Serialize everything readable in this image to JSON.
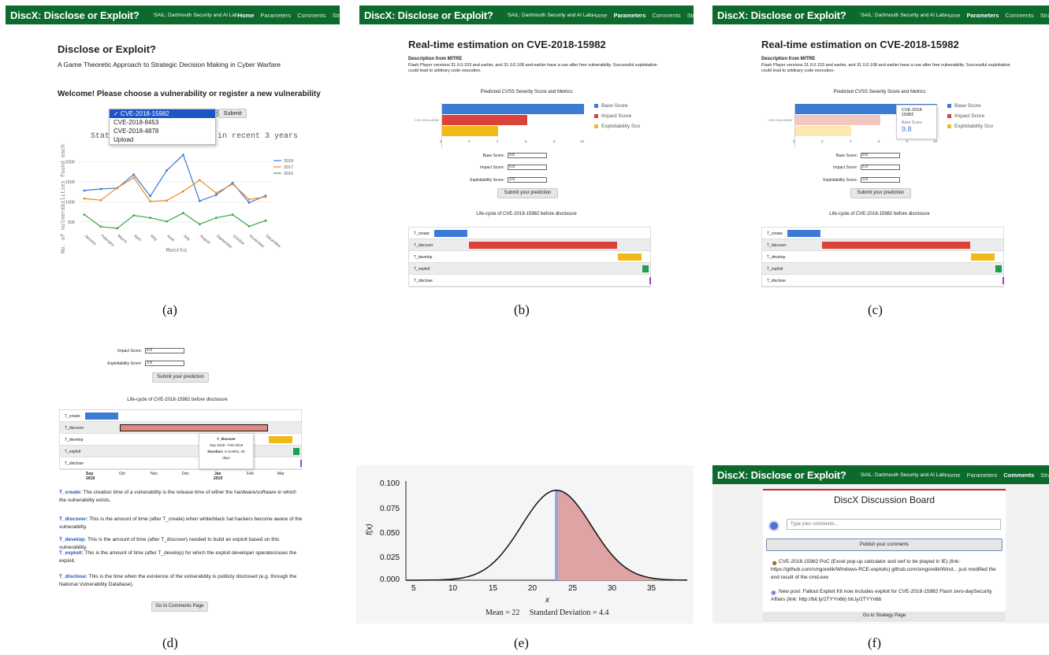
{
  "nav": {
    "brand": "DiscX: Disclose or Exploit?",
    "lab": "DSAIL: Dartmouth Security and AI Lab",
    "links": [
      "Home",
      "Parameters",
      "Comments",
      "Strategy"
    ]
  },
  "captions": [
    "(a)",
    "(b)",
    "(c)",
    "(d)",
    "(e)",
    "(f)"
  ],
  "panel_a": {
    "title": "Disclose or Exploit?",
    "subtitle": "A Game Theoretic Approach to Strategic Decision Making in Cyber Warfare",
    "welcome": "Welcome! Please choose a vulnerability or register a new vulnerability",
    "options": [
      "✓ CVE-2018-15982",
      "CVE-2018-8453",
      "CVE-2018-4878",
      "Upload"
    ],
    "submit": "Submit",
    "chart_title_left": "Stati",
    "chart_title_right": "in recent 3 years",
    "ylabel": "No. of vulnerabilities found each year",
    "xlabel": "Months"
  },
  "panel_b": {
    "title": "Real-time estimation on CVE-2018-15982",
    "desc_head": "Description from MITRE",
    "desc": "Flash Player versions 31.0.0.153 and earlier, and 31.0.0.108 and earlier have a use after free vulnerability. Successful exploitation could lead to arbitrary code execution.",
    "chart_head": "Predicted CVSS Severity Score and Metrics",
    "cve_label": "CVE-2018-15982",
    "legend": [
      "Base Score",
      "Impact Score",
      "Exploitability Sco"
    ],
    "fields": [
      {
        "label": "Base Score:",
        "value": "9.8"
      },
      {
        "label": "Impact Score:",
        "value": "5.9"
      },
      {
        "label": "Exploitability Score:",
        "value": "3.9"
      }
    ],
    "submit": "Submit your prediction",
    "lifecycle": "Life-cycle of CVE-2018-15982 before disclosure",
    "rows": [
      "T_create",
      "T_discover",
      "T_develop",
      "T_exploit",
      "T_disclose"
    ],
    "months": [
      "Sep",
      "Oct",
      "Nov",
      "Dec",
      "Jan",
      "Feb",
      "Mar"
    ]
  },
  "panel_c": {
    "tip_title": "CVE-2018-15982",
    "tip_label": "Base Score",
    "tip_value": "9.8"
  },
  "panel_d": {
    "fields": [
      {
        "label": "Impact Score:",
        "value": "5.9"
      },
      {
        "label": "Exploitability Score:",
        "value": "3.9"
      }
    ],
    "tip_title": "T_discover",
    "tip_range": "Sep 2018 - Feb 2019",
    "tip_duration_label": "Duration:",
    "tip_duration": "4 months, 20 days",
    "year": "2018",
    "year2": "2019",
    "defs": [
      {
        "term": "T_create:",
        "text": "The creation time of a vulnerability is the release time of either the hardware/software in which the vulnerability exists."
      },
      {
        "term": "T_discover:",
        "text": "This is the amount of time (after T_create) when white/black hat hackers become aware of the vulnerability."
      },
      {
        "term": "T_develop:",
        "text": "This is the amount of time (after T_discover) needed to build an exploit based on this vulnerability."
      },
      {
        "term": "T_exploit:",
        "text": "This is the amount of time (after T_develop) for which the exploit developer operates/uses the exploit."
      },
      {
        "term": "T_disclose:",
        "text": "This is the time when the existence of the vulnerability is publicly disclosed (e.g. through the National Vulnerability Database)."
      }
    ],
    "go_comments": "Go to Comments Page"
  },
  "panel_e": {
    "yticks": [
      "0.100",
      "0.075",
      "0.050",
      "0.025",
      "0.000"
    ],
    "xticks": [
      "5",
      "10",
      "15",
      "20",
      "25",
      "30",
      "35"
    ],
    "ylabel": "f(x)",
    "xlabel": "x",
    "stats": "Mean = 22     Standard Deviation = 4.4"
  },
  "panel_f": {
    "board_title": "DiscX Discussion Board",
    "placeholder": "Type your comments...",
    "publish": "Publish your comments",
    "post1": "CVE-2018-15982 PoC (Excel pop-up calculator and swf to be played in IE) (link: https://github.com/smgorelik/Windows-RCE-exploits) github.com/smgorelik/Wind... just modified the end result of the cmd.exe",
    "post2": "New post: Fallout Exploit Kit now includes exploit for CVE-2018-15982 Flash zero-daySecurity Affairs (link: http://bit.ly/2TYYn6b) bit.ly/2TYYn6b",
    "go_strategy": "Go to Strategy Page"
  },
  "chart_data": {
    "type": "line",
    "categories": [
      "January",
      "February",
      "March",
      "April",
      "May",
      "June",
      "July",
      "August",
      "September",
      "October",
      "November",
      "December"
    ],
    "series": [
      {
        "name": "2018",
        "values": [
          1280,
          1320,
          1340,
          1680,
          1140,
          1780,
          2170,
          1020,
          1170,
          1470,
          980,
          1150
        ]
      },
      {
        "name": "2017",
        "values": [
          1080,
          1040,
          1350,
          1600,
          1010,
          1030,
          1260,
          1540,
          1220,
          1440,
          1060,
          1120
        ]
      },
      {
        "name": "2016",
        "values": [
          680,
          380,
          340,
          660,
          600,
          510,
          720,
          440,
          600,
          680,
          390,
          530
        ]
      }
    ],
    "yticks": [
      "500",
      "1000",
      "1500",
      "2000"
    ],
    "ylim": [
      300,
      2300
    ],
    "colors": [
      "#3b7bd4",
      "#f08a24",
      "#3aa845"
    ]
  }
}
